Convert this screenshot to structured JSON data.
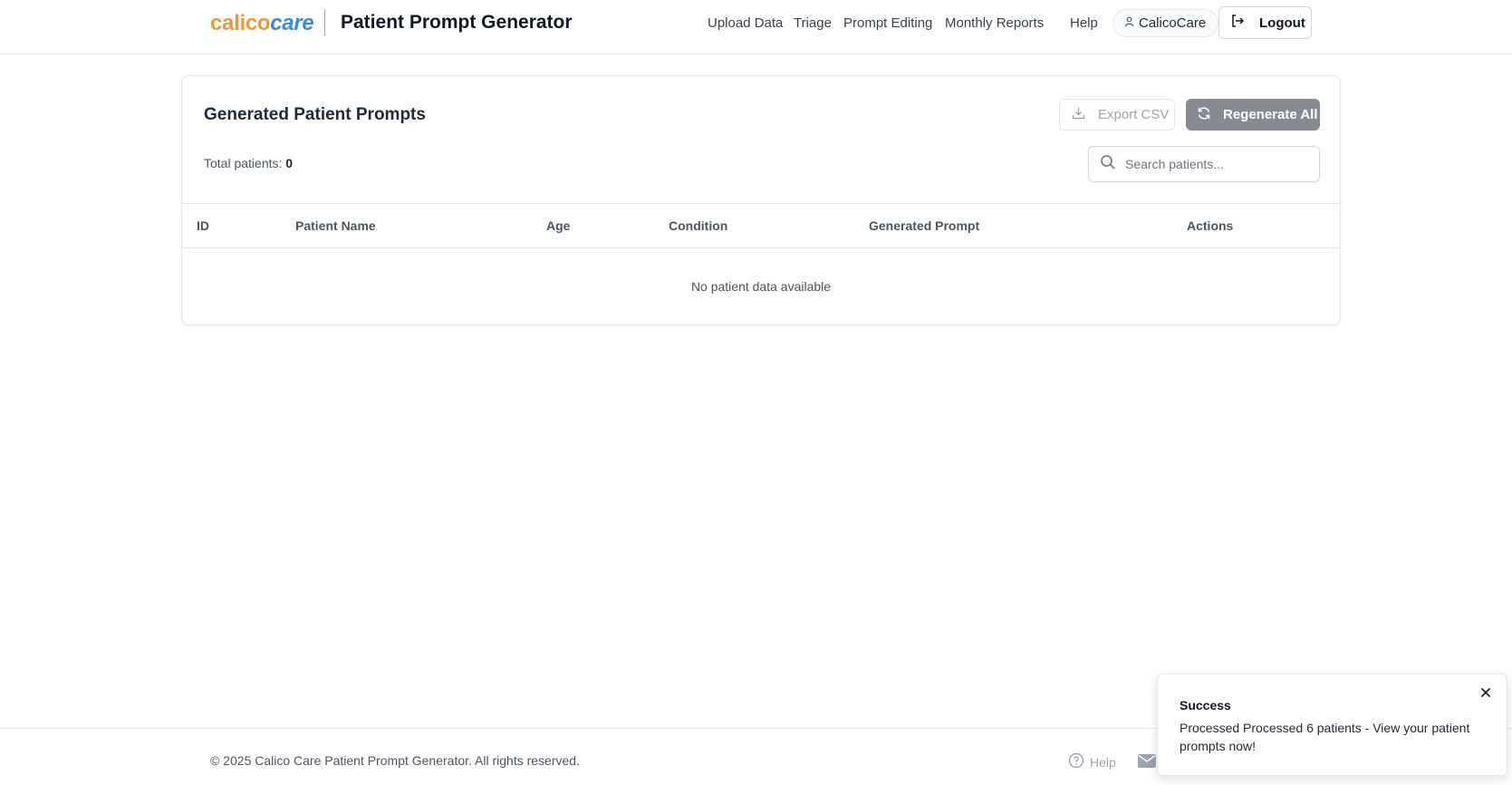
{
  "header": {
    "logo_part1": "calico",
    "logo_part2": "care",
    "title": "Patient Prompt Generator",
    "nav": [
      "Upload Data",
      "Triage",
      "Prompt Editing",
      "Monthly Reports",
      "Help"
    ],
    "user": "CalicoCare",
    "logout": "Logout"
  },
  "card": {
    "title": "Generated Patient Prompts",
    "export_label": "Export CSV",
    "regenerate_label": "Regenerate All",
    "total_label": "Total patients:",
    "total_value": "0",
    "search_placeholder": "Search patients...",
    "columns": [
      "ID",
      "Patient Name",
      "Age",
      "Condition",
      "Generated Prompt",
      "Actions"
    ],
    "empty_message": "No patient data available"
  },
  "footer": {
    "copyright": "© 2025 Calico Care Patient Prompt Generator. All rights reserved.",
    "help": "Help"
  },
  "toast": {
    "title": "Success",
    "message": "Processed Processed 6 patients - View your patient prompts now!"
  },
  "colors": {
    "logo_orange": "#ea9a3e",
    "logo_blue": "#3b8bd4",
    "regenerate_bg": "#858a94"
  },
  "icons": [
    "user-icon",
    "logout-icon",
    "download-icon",
    "refresh-icon",
    "search-icon",
    "help-icon",
    "mail-icon",
    "close-icon"
  ]
}
